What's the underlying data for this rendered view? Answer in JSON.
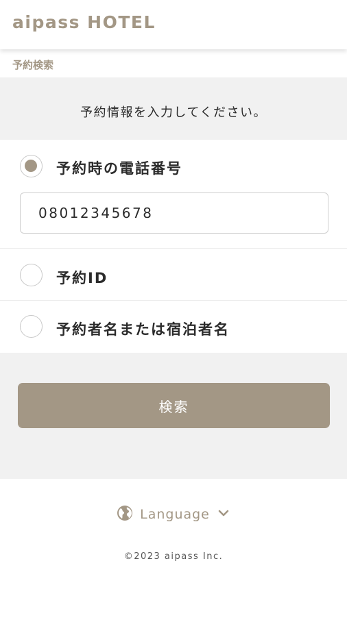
{
  "header": {
    "logo_text": "aipass HOTEL"
  },
  "breadcrumb": {
    "label": "予約検索"
  },
  "instruction": {
    "text": "予約情報を入力してください。"
  },
  "search_options": [
    {
      "label": "予約時の電話番号",
      "selected": true
    },
    {
      "label": "予約ID",
      "selected": false
    },
    {
      "label": "予約者名または宿泊者名",
      "selected": false
    }
  ],
  "phone_input": {
    "value": "08012345678"
  },
  "search_button": {
    "label": "検索"
  },
  "language_selector": {
    "label": "Language",
    "icon": "globe-icon",
    "dropdown_icon": "chevron-down-icon"
  },
  "footer": {
    "copyright": "©2023 aipass Inc."
  },
  "colors": {
    "accent": "#a39785",
    "band_background": "#f1f1f1",
    "text": "#2b2b2b"
  }
}
